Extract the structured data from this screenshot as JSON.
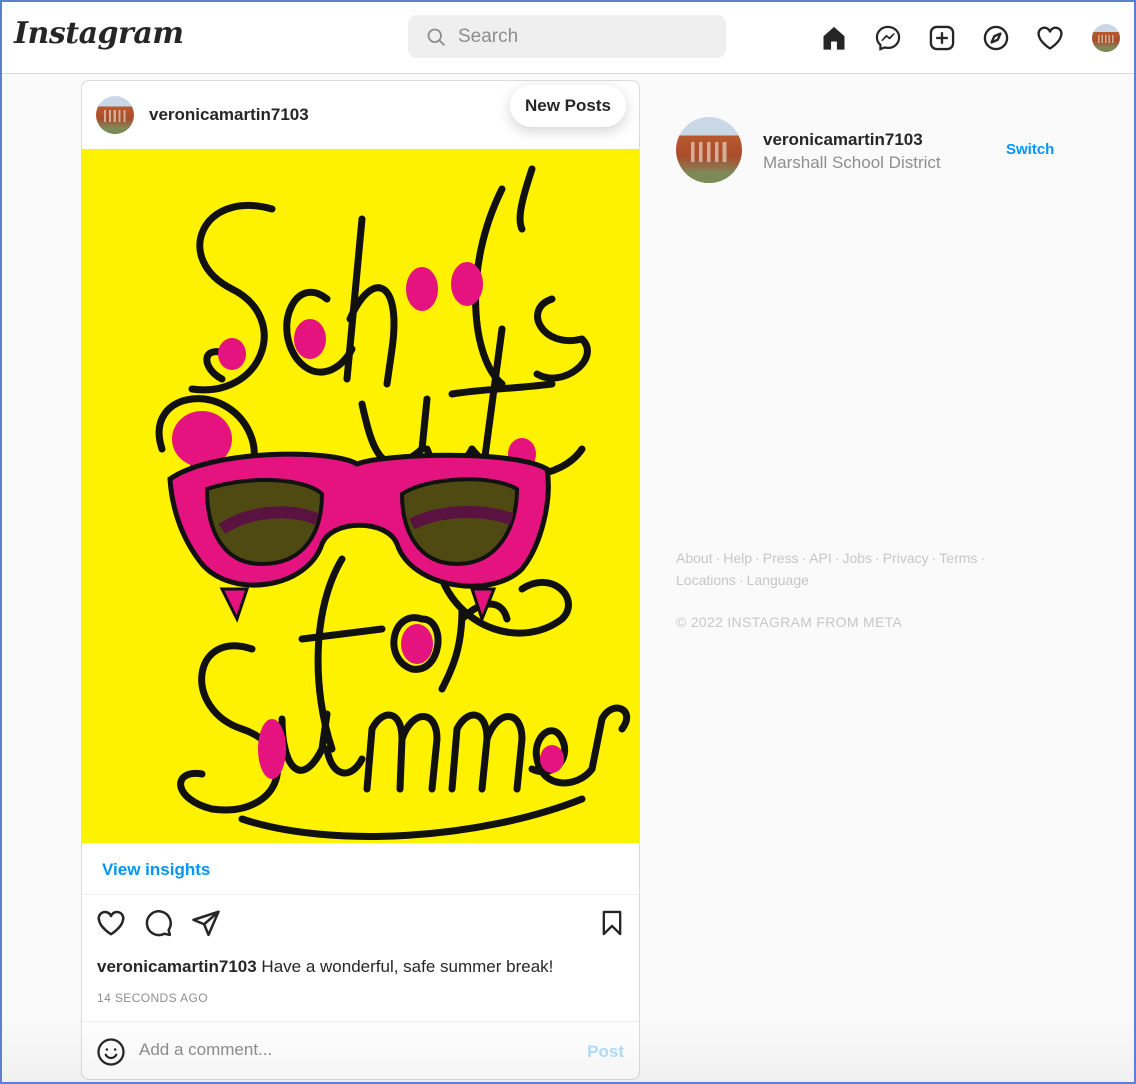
{
  "nav": {
    "logo": "Instagram",
    "search_placeholder": "Search",
    "icons": [
      "home-icon",
      "messenger-icon",
      "new-post-icon",
      "explore-icon",
      "activity-heart-icon",
      "profile-avatar"
    ]
  },
  "post": {
    "username": "veronicamartin7103",
    "new_posts_label": "New Posts",
    "image_text": "School's out for Summer",
    "insights_label": "View insights",
    "caption_user": "veronicamartin7103",
    "caption_text": " Have a wonderful, safe summer break!",
    "timestamp": "14 SECONDS AGO",
    "comment_placeholder": "Add a comment...",
    "post_button": "Post"
  },
  "sidebar": {
    "username": "veronicamartin7103",
    "subtitle": "Marshall School District",
    "switch_label": "Switch",
    "footer_links": [
      "About",
      "Help",
      "Press",
      "API",
      "Jobs",
      "Privacy",
      "Terms",
      "Locations",
      "Language"
    ],
    "copyright": "© 2022 INSTAGRAM FROM META"
  },
  "colors": {
    "accent_blue": "#0095f6",
    "post_disabled": "#b2dffc",
    "image_yellow": "#fff200",
    "image_pink": "#e5137f"
  }
}
